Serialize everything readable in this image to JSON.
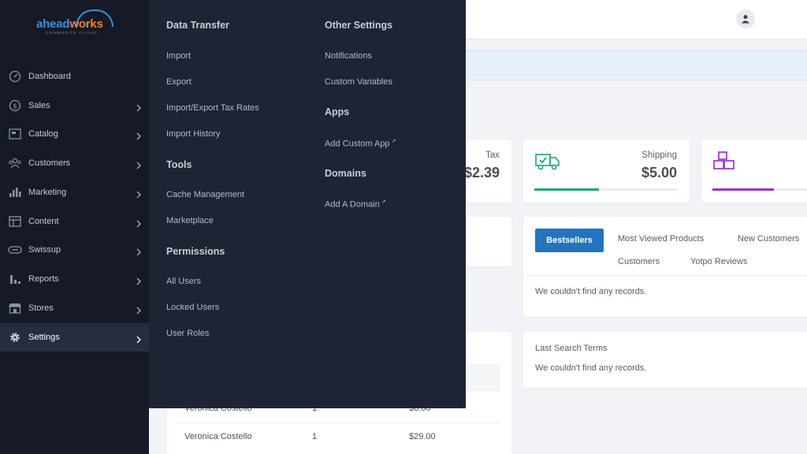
{
  "logo": {
    "brand_part1": "ahead",
    "brand_part2": "works",
    "tagline": "COMMERCE CLOUD"
  },
  "sidebar": {
    "items": [
      {
        "label": "Dashboard",
        "icon": "dashboard-icon"
      },
      {
        "label": "Sales",
        "icon": "dollar-icon"
      },
      {
        "label": "Catalog",
        "icon": "box-icon"
      },
      {
        "label": "Customers",
        "icon": "users-icon"
      },
      {
        "label": "Marketing",
        "icon": "megaphone-icon"
      },
      {
        "label": "Content",
        "icon": "layout-icon"
      },
      {
        "label": "Swissup",
        "icon": "toggle-icon"
      },
      {
        "label": "Reports",
        "icon": "bar-chart-icon"
      },
      {
        "label": "Stores",
        "icon": "store-icon"
      },
      {
        "label": "Settings",
        "icon": "gear-icon"
      }
    ],
    "active": "Settings"
  },
  "dropdown": {
    "data_transfer": {
      "title": "Data Transfer",
      "links": [
        "Import",
        "Export",
        "Import/Export Tax Rates",
        "Import History"
      ]
    },
    "tools": {
      "title": "Tools",
      "links": [
        "Cache Management",
        "Marketplace"
      ]
    },
    "permissions": {
      "title": "Permissions",
      "links": [
        "All Users",
        "Locked Users",
        "User Roles"
      ]
    },
    "other_settings": {
      "title": "Other Settings",
      "links": [
        "Notifications",
        "Custom Variables"
      ]
    },
    "apps": {
      "title": "Apps",
      "links": [
        "Add Custom App"
      ]
    },
    "domains": {
      "title": "Domains",
      "links": [
        "Add A Domain"
      ]
    },
    "external_mark": "↗"
  },
  "stats": {
    "tax": {
      "label": "Tax",
      "value": "$2.39"
    },
    "shipping": {
      "label": "Shipping",
      "value": "$5.00",
      "progress": 0.45,
      "color": "#1aa57a"
    },
    "quantity": {
      "progress": 0.6,
      "color": "#9b30d9"
    }
  },
  "tabs": {
    "active": "Bestsellers",
    "others": [
      "Most Viewed Products",
      "New Customers",
      "Customers",
      "Yotpo Reviews"
    ],
    "empty_message": "We couldn't find any records."
  },
  "last_search": {
    "title": "Last Search Terms",
    "empty_message": "We couldn't find any records."
  },
  "table": {
    "rows": [
      {
        "name": "Veronica Costello",
        "qty": "1",
        "total": "$0.00"
      },
      {
        "name": "Veronica Costello",
        "qty": "1",
        "total": "$29.00"
      }
    ]
  },
  "colors": {
    "accent": "#2374be",
    "sidebar": "#151a26",
    "dropdown": "#1e2433"
  }
}
